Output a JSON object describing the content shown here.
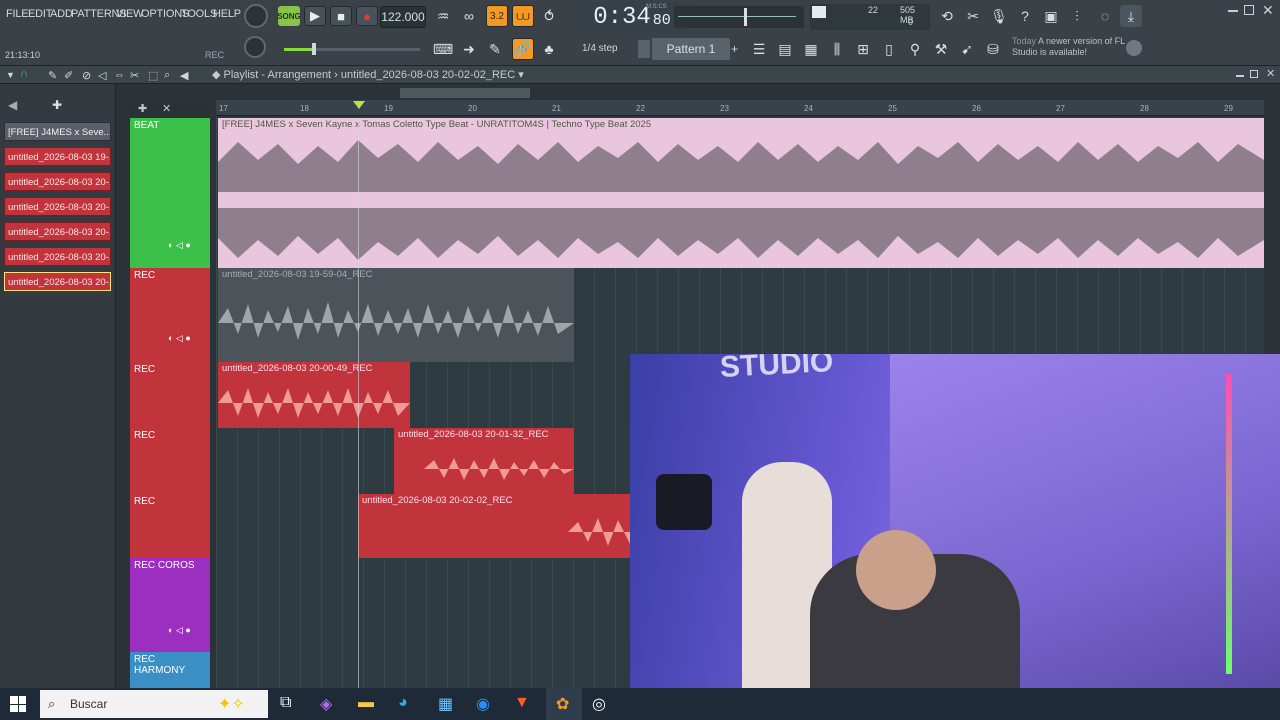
{
  "menu": [
    "FILE",
    "EDIT",
    "ADD",
    "PATTERNS",
    "VIEW",
    "OPTIONS",
    "TOOLS",
    "HELP"
  ],
  "transport": {
    "mode": "SONG",
    "bpm": "122.000",
    "time": "0:34",
    "time_frac": "80",
    "time_unit": "M:S:CS",
    "cpu": "22",
    "mem": "505 MB",
    "poly": "0",
    "snap": "1/4 step",
    "pattern": "Pattern 1"
  },
  "clock": "21:13:10",
  "rec_label": "REC",
  "notice": {
    "when": "Today",
    "text": "A newer version of FL Studio is available!"
  },
  "playlist": {
    "breadcrumb": "Playlist - Arrangement",
    "arrangement": "untitled_2026-08-03 20-02-02_REC",
    "ruler": [
      "17",
      "18",
      "19",
      "20",
      "21",
      "22",
      "23",
      "24",
      "25",
      "26",
      "27",
      "28",
      "29"
    ]
  },
  "clip_list": [
    "[FREE] J4MES x Seve...",
    "untitled_2026-08-03 19-...",
    "untitled_2026-08-03 20-...",
    "untitled_2026-08-03 20-...",
    "untitled_2026-08-03 20-...",
    "untitled_2026-08-03 20-...",
    "untitled_2026-08-03 20-..."
  ],
  "tracks": [
    "BEAT",
    "REC",
    "REC",
    "REC",
    "REC",
    "REC COROS",
    "REC HARMONY"
  ],
  "clips": {
    "beat": "[FREE] J4MES x Seven Kayne x Tomas Coletto Type Beat - UNRATITOM4S | Techno Type Beat 2025",
    "rec1": "untitled_2026-08-03 19-59-04_REC",
    "rec2": "untitled_2026-08-03 20-00-49_REC",
    "rec3": "untitled_2026-08-03 20-01-32_REC",
    "rec4": "untitled_2026-08-03 20-02-02_REC"
  },
  "webcam": {
    "sign": "STUDIO"
  },
  "taskbar": {
    "search_placeholder": "Buscar"
  },
  "colors": {
    "beat": "#e9c6de",
    "rec": "#c1343c",
    "rec_wave": "#f09a9a",
    "green_track": "#3dc04a",
    "coros": "#9c2fc0",
    "harmony": "#3a8fc4"
  }
}
